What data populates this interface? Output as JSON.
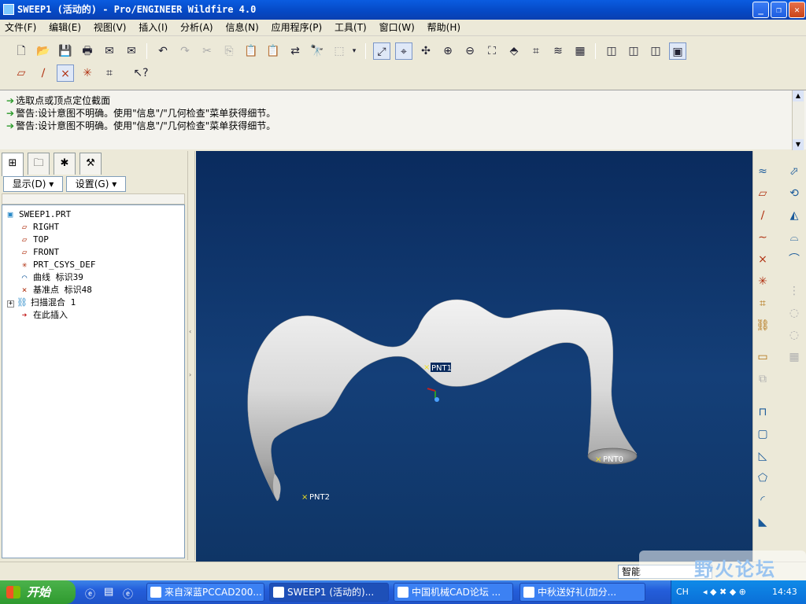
{
  "window": {
    "title": "SWEEP1 (活动的) - Pro/ENGINEER Wildfire 4.0"
  },
  "menu": [
    "文件(F)",
    "编辑(E)",
    "视图(V)",
    "插入(I)",
    "分析(A)",
    "信息(N)",
    "应用程序(P)",
    "工具(T)",
    "窗口(W)",
    "帮助(H)"
  ],
  "messages": [
    {
      "icon": "arrow-icon",
      "text": "选取点或顶点定位截面"
    },
    {
      "icon": "arrow-icon",
      "text": "警告:设计意图不明确。使用\"信息\"/\"几何检查\"菜单获得细节。"
    },
    {
      "icon": "arrow-icon",
      "text": "警告:设计意图不明确。使用\"信息\"/\"几何检查\"菜单获得细节。"
    }
  ],
  "panel": {
    "show_label": "显示(D)",
    "settings_label": "设置(G)"
  },
  "tree": {
    "root": "SWEEP1.PRT",
    "items": [
      "RIGHT",
      "TOP",
      "FRONT",
      "PRT_CSYS_DEF",
      "曲线 标识39",
      "基准点 标识48",
      "扫描混合 1",
      "在此插入"
    ]
  },
  "viewport": {
    "labels": {
      "pnt0": "PNT0",
      "pnt1": "PNT1",
      "pnt2": "PNT2"
    }
  },
  "status": {
    "filter": "智能"
  },
  "taskbar": {
    "start": "开始",
    "tasks": [
      "来自深蓝PCCAD200...",
      "SWEEP1 (活动的)...",
      "中国机械CAD论坛 ...",
      "中秋送好礼(加分..."
    ],
    "lang": "CH",
    "clock": "14:43"
  },
  "watermark": "野火论坛",
  "colors": {
    "viewport_top": "#0a2b5e",
    "viewport_bottom": "#143f78",
    "titlebar": "#0548c4",
    "taskbar": "#245edb"
  }
}
